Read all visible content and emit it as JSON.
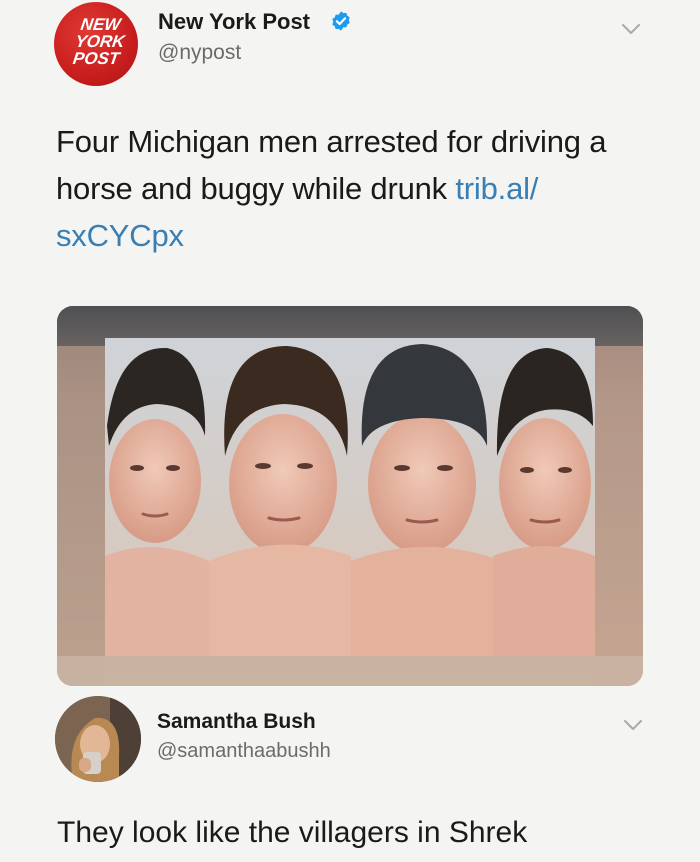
{
  "main_tweet": {
    "author_name": "New York Post",
    "author_handle": "@nypost",
    "verified": true,
    "text_before_link": "Four Michigan men arrested for driving a horse and buggy while drunk ",
    "link_text": "trib.al/\nsxCYCpx",
    "link_display": "trib.al/sxCYCpx",
    "logo_text": [
      "NEW",
      "YORK",
      "POST"
    ],
    "media_description": "four mugshots side by side"
  },
  "reply_tweet": {
    "author_name": "Samantha Bush",
    "author_handle": "@samanthaabushh",
    "text": "They look like the villagers in Shrek"
  },
  "colors": {
    "link": "#3a7fb3",
    "verified": "#1d9bf0",
    "nyp_red": "#c81e1e",
    "handle_gray": "#6b6b6b"
  },
  "icons": {
    "verified": "verified-badge-icon",
    "more": "chevron-down-icon"
  }
}
